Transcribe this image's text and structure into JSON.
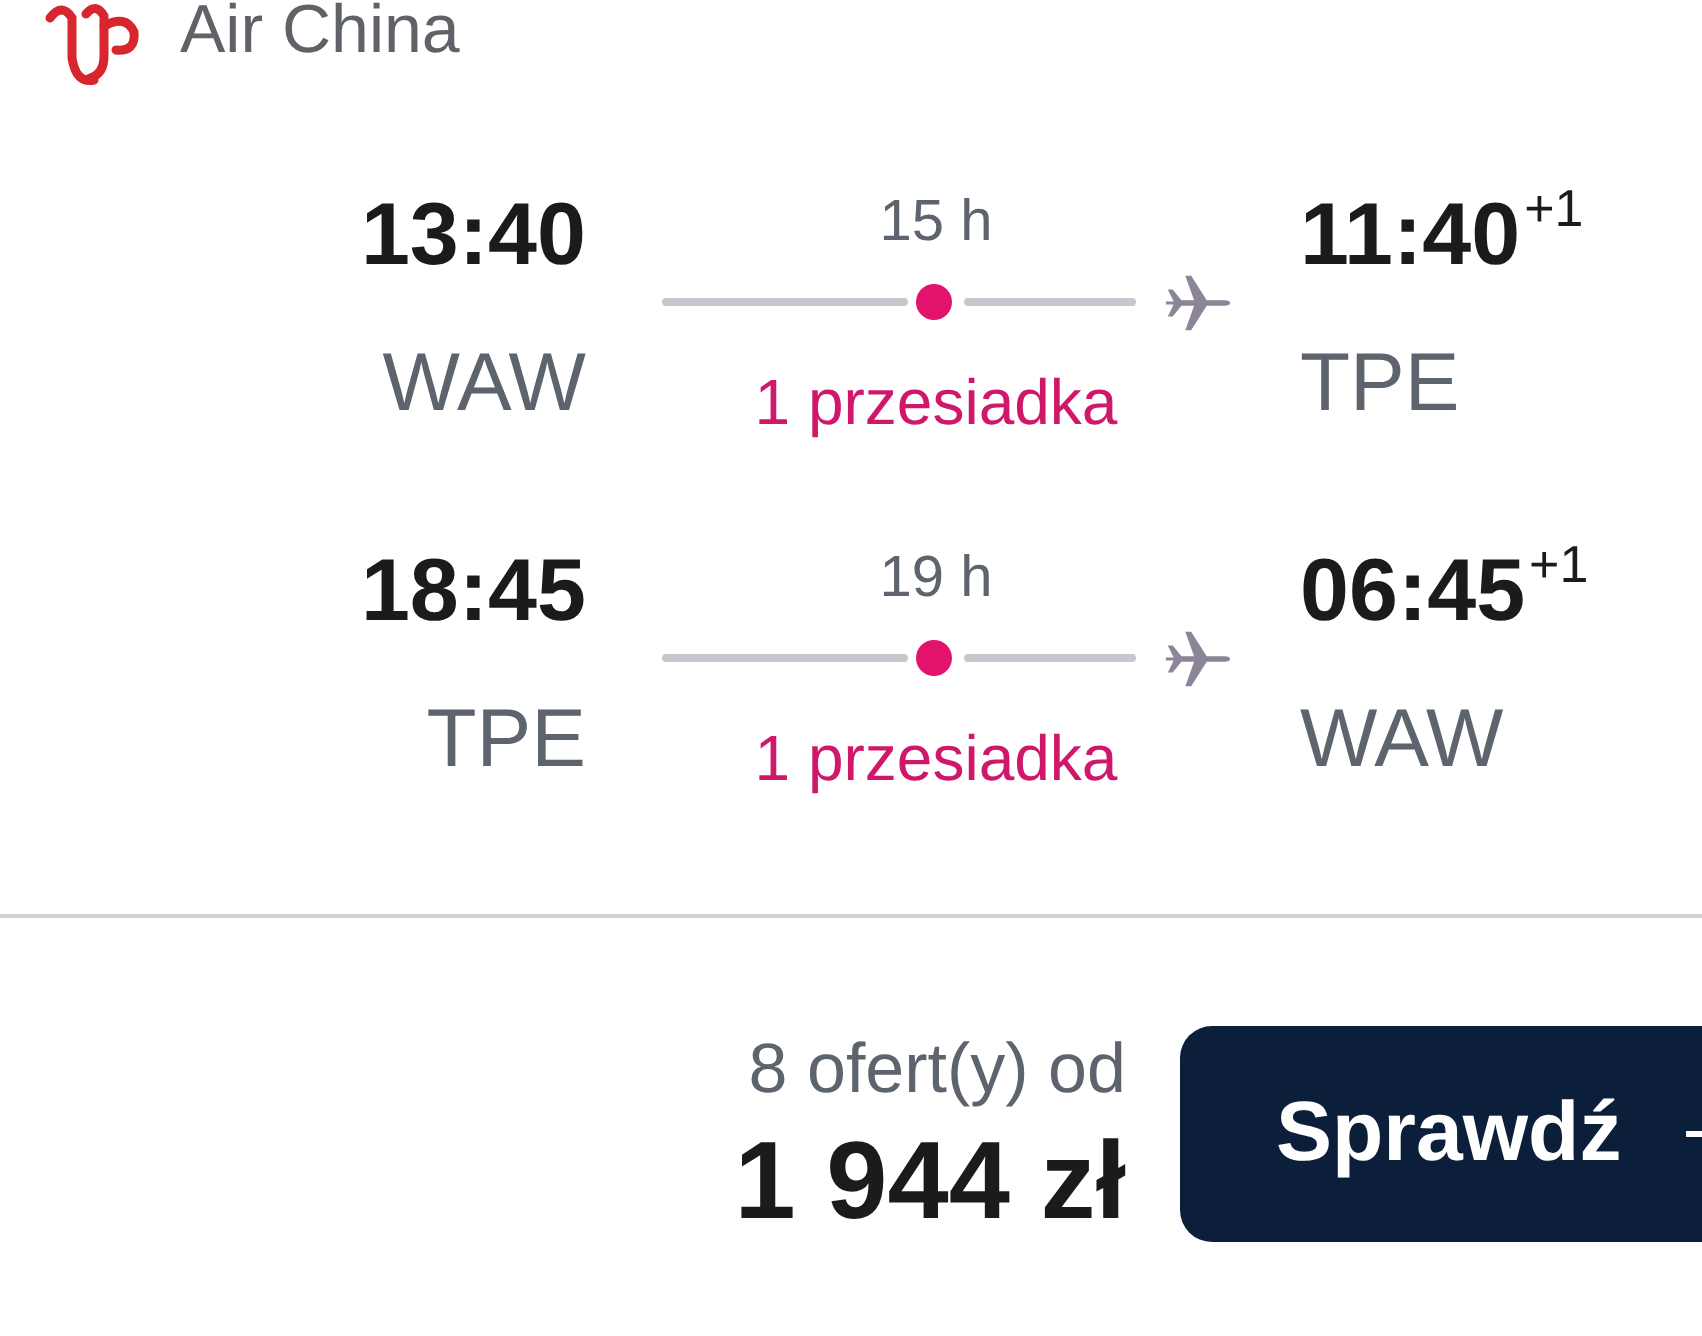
{
  "header": {
    "airline": "Air China"
  },
  "flights": [
    {
      "departure_time": "13:40",
      "departure_airport": "WAW",
      "duration": "15 h",
      "stops": "1 przesiadka",
      "arrival_time": "11:40$^{+1}$",
      "arrival_airport": "TPE"
    },
    {
      "departure_time": "18:45",
      "departure_airport": "TPE",
      "duration": "19 h",
      "stops": "1 przesiadka",
      "arrival_time": "06:45$^{+1}$",
      "arrival_airport": "WAW"
    }
  ],
  "offer": {
    "offers": "8 ofert(y) od",
    "price": "1 944 zł",
    "button": "Sprawdź"
  }
}
